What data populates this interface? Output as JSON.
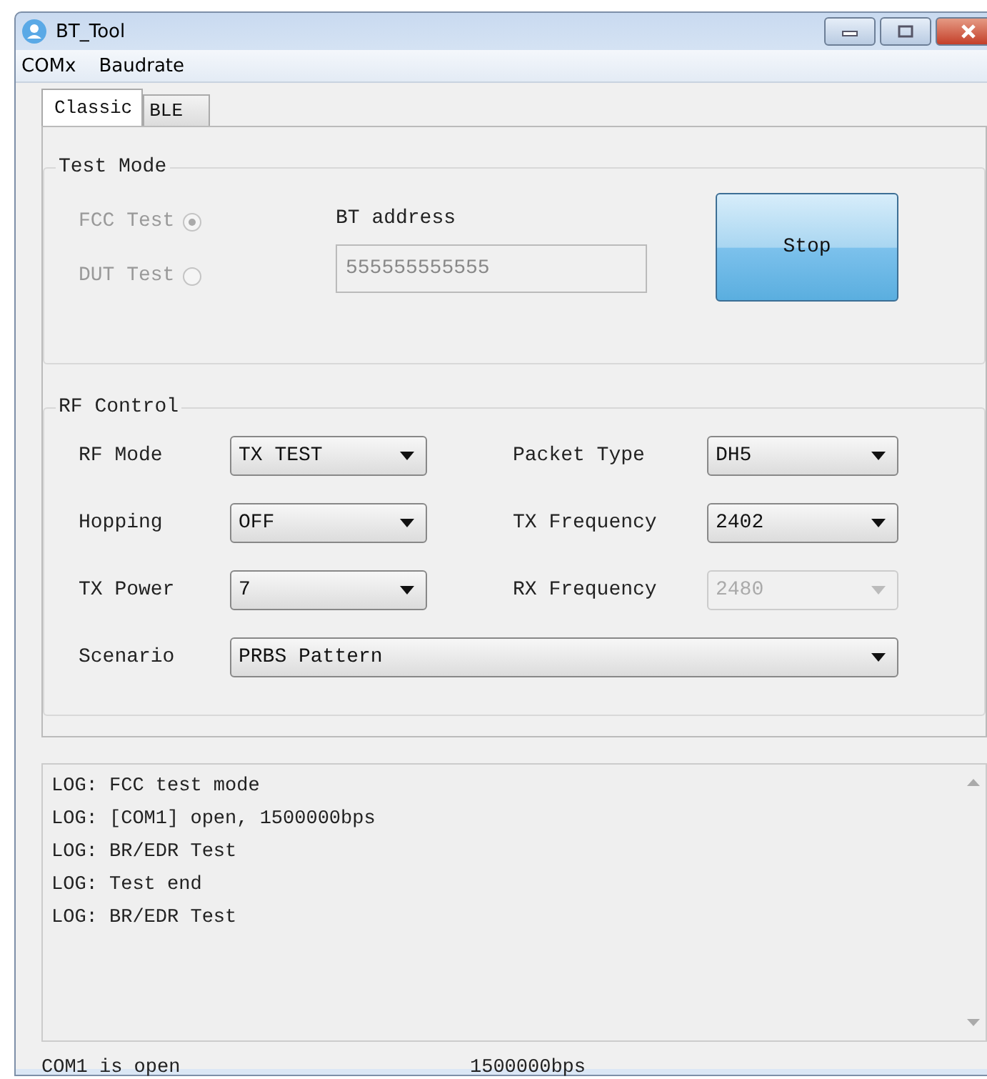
{
  "window": {
    "title": "BT_Tool"
  },
  "menu": [
    {
      "label": "COMx"
    },
    {
      "label": "Baudrate"
    }
  ],
  "tabs": [
    {
      "label": "Classic",
      "selected": true
    },
    {
      "label": "BLE",
      "selected": false
    }
  ],
  "test_mode": {
    "title": "Test Mode",
    "disabled": true,
    "options": [
      {
        "label": "FCC Test",
        "selected": true
      },
      {
        "label": "DUT Test",
        "selected": false
      }
    ],
    "address_label": "BT address",
    "address": "555555555555",
    "stop_button": "Stop"
  },
  "rf_control": {
    "title": "RF Control",
    "fields": [
      {
        "label": "RF Mode",
        "value": "TX TEST",
        "disabled": false
      },
      {
        "label": "Packet Type",
        "value": "DH5",
        "disabled": false
      },
      {
        "label": "Hopping",
        "value": "OFF",
        "disabled": false
      },
      {
        "label": "TX Frequency",
        "value": "2402",
        "disabled": false
      },
      {
        "label": "TX Power",
        "value": "7",
        "disabled": false
      },
      {
        "label": "RX Frequency",
        "value": "2480",
        "disabled": true
      }
    ],
    "scenario": {
      "label": "Scenario",
      "value": "PRBS Pattern",
      "disabled": false
    }
  },
  "log": {
    "lines": [
      "LOG: FCC test mode",
      "LOG: [COM1] open, 1500000bps",
      "LOG: BR/EDR Test",
      "LOG: Test end",
      "LOG: BR/EDR Test"
    ]
  },
  "status_bar": {
    "port": "COM1 is open",
    "baud": "1500000bps"
  }
}
